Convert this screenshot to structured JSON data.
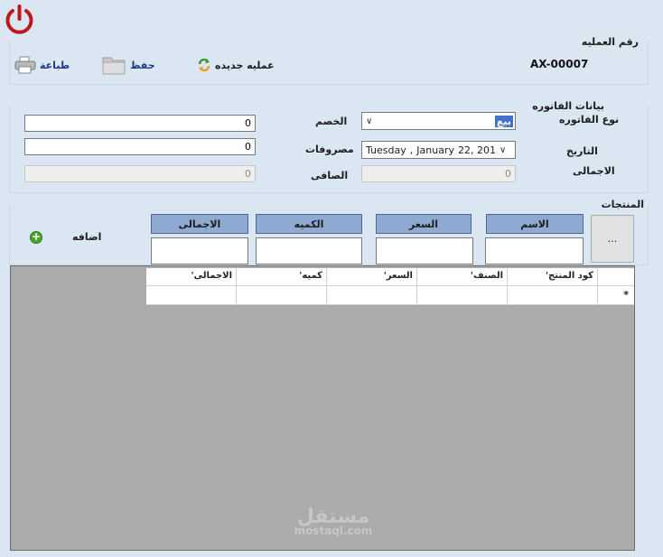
{
  "toolbar": {
    "group_title": "رقم العمليه",
    "invoice_number": "AX-00007",
    "new_op_label": "عمليه جديده",
    "save_label": "حفظ",
    "print_label": "طباعة"
  },
  "invoice": {
    "group_title": "بيانات الفاتوره",
    "type_label": "نوع الفاتوره",
    "type_value": "بيع",
    "date_label": "التاريخ",
    "date_day": "Tuesday",
    "date_sep": ",",
    "date_month": "January",
    "date_rest": "22, 201",
    "total_label": "الاجمالى",
    "total_value": "0",
    "discount_label": "الخصم",
    "discount_value": "0",
    "expenses_label": "مصروفات",
    "expenses_value": "0",
    "net_label": "الصافى",
    "net_value": "0"
  },
  "products": {
    "group_title": "المنتجات",
    "col_name": "الاسم",
    "col_price": "السعر",
    "col_qty": "الكميه",
    "col_total": "الاجمالى",
    "browse_label": "...",
    "add_label": "اضافه",
    "add_icon": "+"
  },
  "grid": {
    "columns": [
      "'الاجمالى",
      "'كميه",
      "'السعر",
      "'الصنف",
      "'كود المنتج"
    ],
    "new_row_marker": "*"
  },
  "watermark": {
    "big": "مستقل",
    "small": "mostaql.com"
  },
  "colors": {
    "background": "#dbe6f3",
    "header_button": "#8eaad2",
    "grid_bg": "#ababab",
    "power_icon": "#c0171d",
    "selection": "#3d72c8"
  }
}
